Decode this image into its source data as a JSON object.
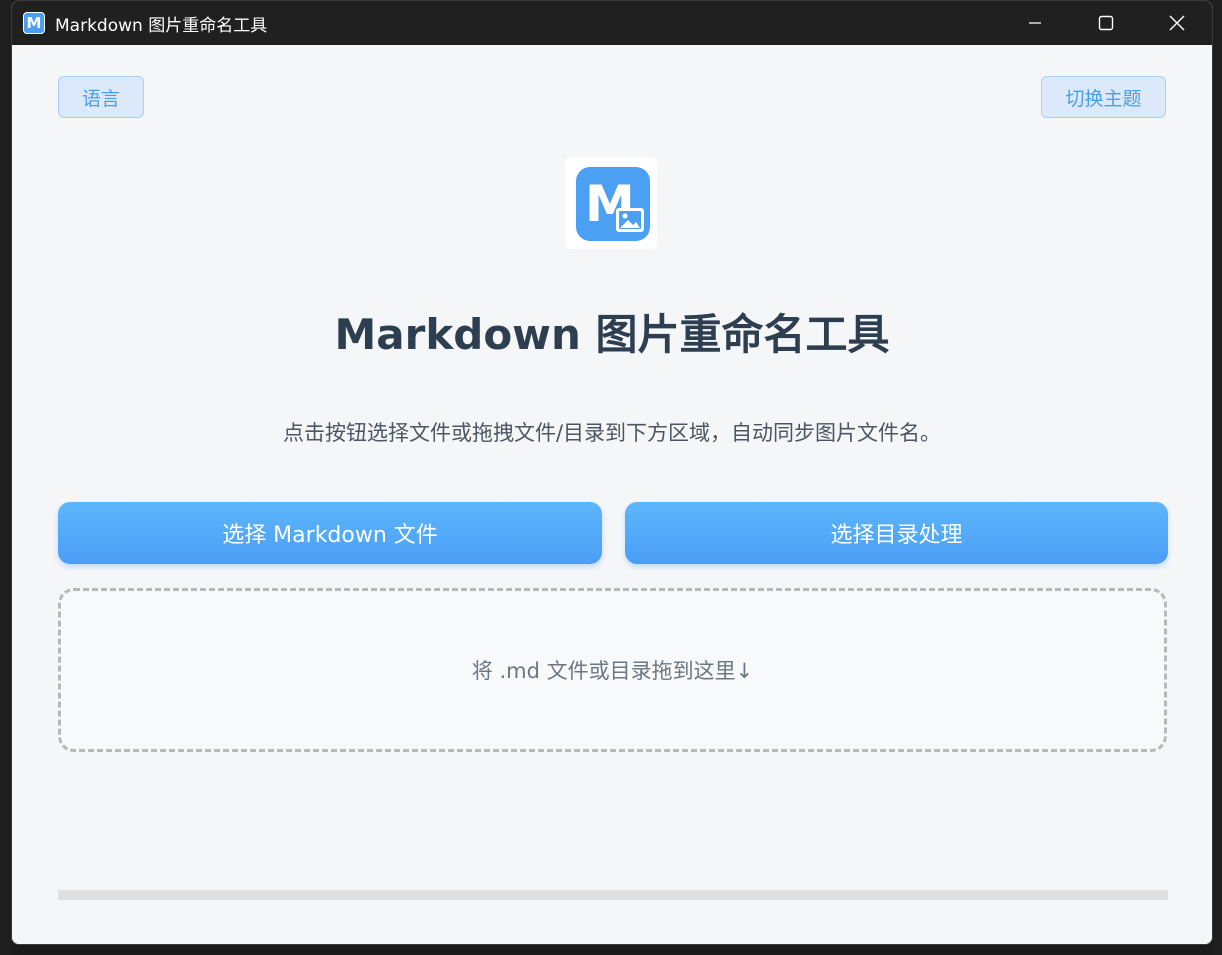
{
  "window": {
    "title": "Markdown 图片重命名工具",
    "app_icon_letter": "M"
  },
  "toolbar": {
    "language_label": "语言",
    "theme_label": "切换主题"
  },
  "main": {
    "logo_letter": "M",
    "title": "Markdown 图片重命名工具",
    "subtitle": "点击按钮选择文件或拖拽文件/目录到下方区域，自动同步图片文件名。",
    "select_file_label": "选择 Markdown 文件",
    "select_dir_label": "选择目录处理",
    "dropzone_text": "将 .md 文件或目录拖到这里↓"
  },
  "progress": {
    "value": 0
  },
  "colors": {
    "accent": "#4a9ef6",
    "title_text": "#2c3e50",
    "titlebar": "#202020"
  },
  "icons": {
    "minimize": "minimize-icon",
    "maximize": "maximize-icon",
    "close": "close-icon",
    "logo": "markdown-image-icon"
  }
}
